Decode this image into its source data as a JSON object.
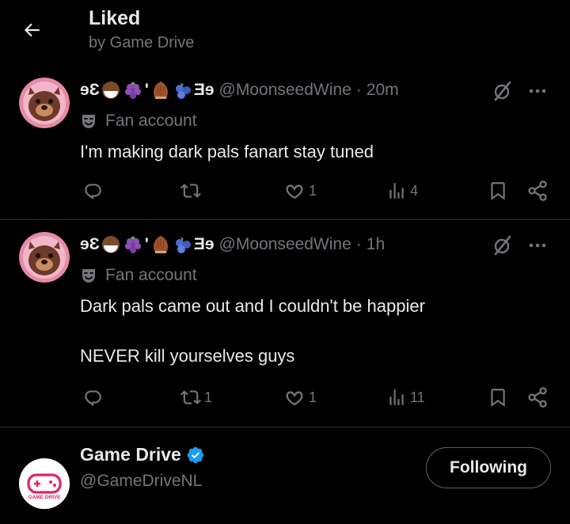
{
  "header": {
    "title": "Liked",
    "subtitle": "by Game Drive"
  },
  "posts": [
    {
      "name_prefix": "ɘƐ",
      "name_suffix": "Ǝɘ",
      "emojis": [
        "coconut-emoji",
        "grapes-emoji",
        "chestnut-emoji",
        "blueberries-emoji"
      ],
      "handle": "@MoonseedWine",
      "dot": "·",
      "time": "20m",
      "badge": "Fan account",
      "lines": [
        "I'm making dark pals fanart stay tuned"
      ],
      "reply_count": "",
      "repost_count": "",
      "like_count": "1",
      "view_count": "4"
    },
    {
      "name_prefix": "ɘƐ",
      "name_suffix": "Ǝɘ",
      "emojis": [
        "coconut-emoji",
        "grapes-emoji",
        "chestnut-emoji",
        "blueberries-emoji"
      ],
      "handle": "@MoonseedWine",
      "dot": "·",
      "time": "1h",
      "badge": "Fan account",
      "lines": [
        "Dark pals came out and I couldn't be happier",
        "NEVER kill yourselves guys"
      ],
      "reply_count": "",
      "repost_count": "1",
      "like_count": "1",
      "view_count": "11"
    }
  ],
  "suggestion": {
    "name": "Game Drive",
    "handle": "@GameDriveNL",
    "button_label": "Following",
    "logo_text": "GAME DRIVE"
  },
  "colors": {
    "background": "#000000",
    "text": "#e7e9ea",
    "muted": "#71767b",
    "divider": "#2f3336",
    "verified": "#1d9bf0",
    "logo_red": "#e0245e"
  }
}
